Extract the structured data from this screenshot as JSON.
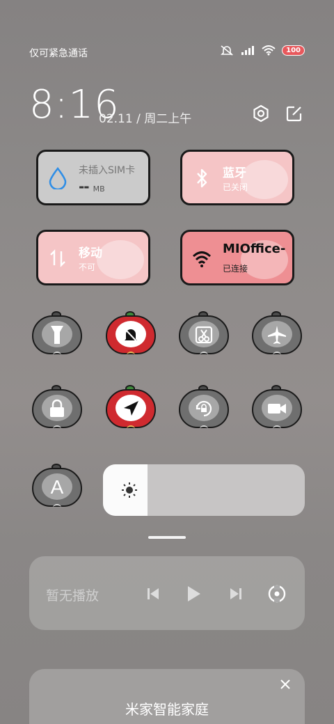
{
  "status_bar": {
    "carrier_text": "仅可紧急通话",
    "battery": "100",
    "icons": [
      "alarm-off-icon",
      "signal-icon",
      "wifi-icon",
      "battery-icon"
    ]
  },
  "header": {
    "time": "8:16",
    "date": "02.11 / 周二上午",
    "icons": [
      "settings-icon",
      "edit-icon"
    ]
  },
  "tiles": {
    "data": {
      "label": "未插入SIM卡",
      "value": "--",
      "unit": "MB",
      "icon": "water-drop-icon"
    },
    "bluetooth": {
      "label": "蓝牙",
      "status": "已关闭",
      "icon": "bluetooth-icon"
    },
    "mobile": {
      "label": "移动",
      "status": "不可",
      "icon": "mobile-data-icon"
    },
    "wifi": {
      "label": "MIOffice-",
      "status": "已连接",
      "icon": "wifi-icon"
    }
  },
  "toggles": [
    {
      "name": "flashlight",
      "icon": "flashlight-icon",
      "on": false
    },
    {
      "name": "mute",
      "icon": "bell-off-icon",
      "on": true
    },
    {
      "name": "screenshot",
      "icon": "scissors-icon",
      "on": false
    },
    {
      "name": "airplane",
      "icon": "airplane-icon",
      "on": false
    },
    {
      "name": "lock-screen",
      "icon": "lock-icon",
      "on": false
    },
    {
      "name": "location",
      "icon": "location-arrow-icon",
      "on": true
    },
    {
      "name": "rotation-lock",
      "icon": "rotation-lock-icon",
      "on": false
    },
    {
      "name": "screen-record",
      "icon": "video-camera-icon",
      "on": false
    },
    {
      "name": "auto-brightness",
      "icon": "letter-a-icon",
      "on": false,
      "glyph": "A"
    }
  ],
  "brightness": {
    "level": 0.22,
    "icon": "sun-icon"
  },
  "media": {
    "title": "暂无播放",
    "controls": [
      "previous-icon",
      "play-icon",
      "next-icon",
      "cast-icon"
    ]
  },
  "smart_home": {
    "title": "米家智能家庭",
    "close_icon": "close-icon"
  },
  "colors": {
    "tile_gray": "#cbcbcb",
    "tile_pink": "#f5c5c6",
    "tile_red": "#ee8f93",
    "apple_on": "#cf2a2f",
    "apple_off": "#6f6f6f"
  }
}
